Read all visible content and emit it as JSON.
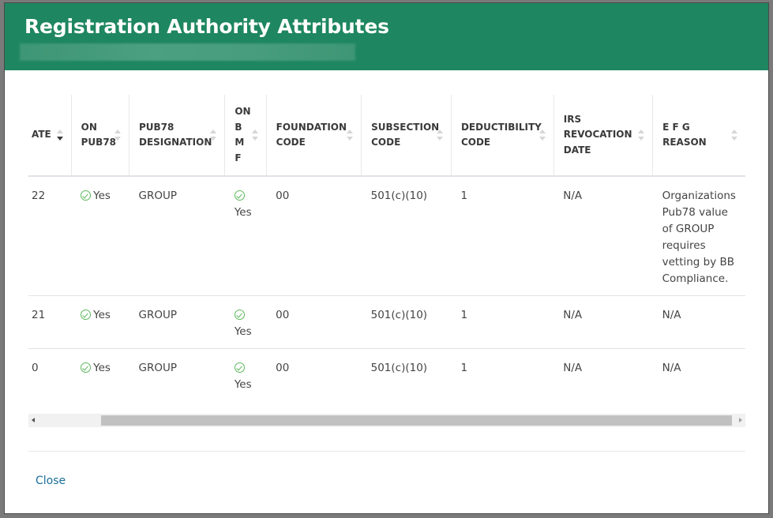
{
  "modal": {
    "title": "Registration Authority Attributes",
    "close_label": "Close"
  },
  "table": {
    "columns": [
      {
        "label": "DATE",
        "partial": "ATE",
        "sort": "desc"
      },
      {
        "label": "ON PUB78",
        "sort": "none"
      },
      {
        "label": "PUB78 DESIGNATION",
        "sort": "none"
      },
      {
        "label": "ON BMF",
        "sort": "none"
      },
      {
        "label": "FOUNDATION CODE",
        "sort": "none"
      },
      {
        "label": "SUBSECTION CODE",
        "sort": "none"
      },
      {
        "label": "DEDUCTIBILITY CODE",
        "sort": "none"
      },
      {
        "label": "IRS REVOCATION DATE",
        "sort": "none"
      },
      {
        "label": "E F G REASON",
        "sort": "none"
      }
    ],
    "rows": [
      {
        "date_partial": "22",
        "on_pub78": "Yes",
        "pub78_designation": "GROUP",
        "on_bmf": "Yes",
        "foundation_code": "00",
        "subsection_code": "501(c)(10)",
        "deductibility_code": "1",
        "irs_revocation_date": "N/A",
        "efg_reason": "Organizations Pub78 value of GROUP requires vetting by BB Compliance."
      },
      {
        "date_partial": "21",
        "on_pub78": "Yes",
        "pub78_designation": "GROUP",
        "on_bmf": "Yes",
        "foundation_code": "00",
        "subsection_code": "501(c)(10)",
        "deductibility_code": "1",
        "irs_revocation_date": "N/A",
        "efg_reason": "N/A"
      },
      {
        "date_partial": "0",
        "on_pub78": "Yes",
        "pub78_designation": "GROUP",
        "on_bmf": "Yes",
        "foundation_code": "00",
        "subsection_code": "501(c)(10)",
        "deductibility_code": "1",
        "irs_revocation_date": "N/A",
        "efg_reason": "N/A"
      }
    ]
  },
  "colors": {
    "header_bg": "#1e8660",
    "check": "#5cb85c",
    "link": "#1a6f9a"
  }
}
